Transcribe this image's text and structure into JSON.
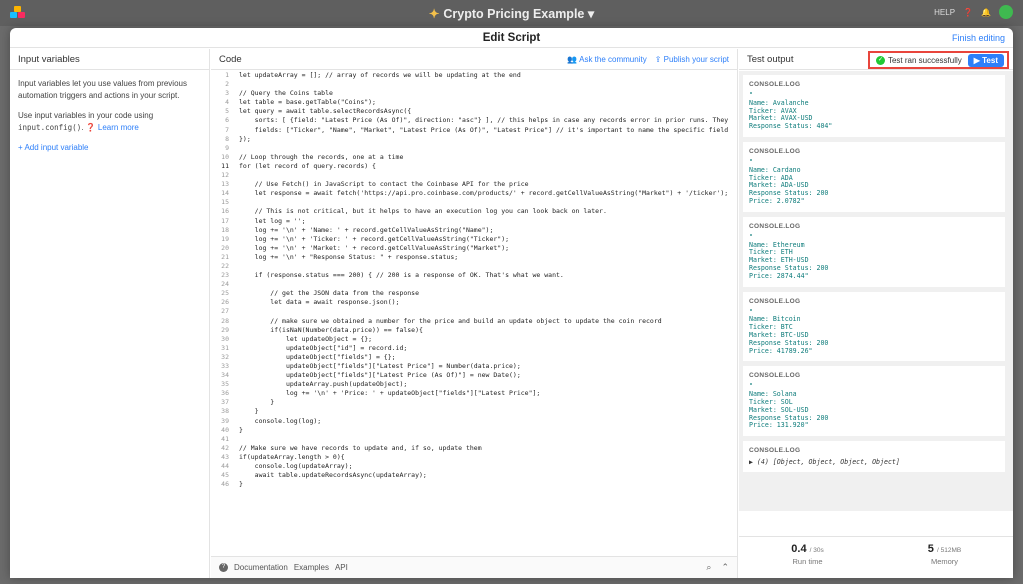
{
  "appbar": {
    "title": "Crypto Pricing Example",
    "help_label": "HELP",
    "icons": [
      "app-logo-icon",
      "sparkle-icon",
      "help-icon",
      "bell-icon",
      "avatar"
    ]
  },
  "modal": {
    "title": "Edit Script",
    "finish_label": "Finish editing"
  },
  "left": {
    "header": "Input variables",
    "para1": "Input variables let you use values from previous automation triggers and actions in your script.",
    "para2_prefix": "Use input variables in your code using",
    "para2_code": "input.config()",
    "para2_suffix": ".",
    "learn_more": "Learn more",
    "add_label": "+ Add input variable"
  },
  "code": {
    "header": "Code",
    "ask_label": "Ask the community",
    "publish_label": "Publish your script",
    "active_line": 11,
    "lines": [
      "let updateArray = []; // array of records we will be updating at the end",
      "",
      "// Query the Coins table",
      "let table = base.getTable(\"Coins\");",
      "let query = await table.selectRecordsAsync({",
      "    sorts: [ {field: \"Latest Price (As Of)\", direction: \"asc\"} ], // this helps in case any records error in prior runs. They",
      "    fields: [\"Ticker\", \"Name\", \"Market\", \"Latest Price (As Of)\", \"Latest Price\"] // it's important to name the specific field",
      "});",
      "",
      "// Loop through the records, one at a time",
      "for (let record of query.records) {",
      "",
      "    // Use Fetch() in JavaScript to contact the Coinbase API for the price",
      "    let response = await fetch('https://api.pro.coinbase.com/products/' + record.getCellValueAsString(\"Market\") + '/ticker');",
      "",
      "    // This is not critical, but it helps to have an execution log you can look back on later.",
      "    let log = '';",
      "    log += '\\n' + 'Name: ' + record.getCellValueAsString(\"Name\");",
      "    log += '\\n' + 'Ticker: ' + record.getCellValueAsString(\"Ticker\");",
      "    log += '\\n' + 'Market: ' + record.getCellValueAsString(\"Market\");",
      "    log += '\\n' + \"Response Status: \" + response.status;",
      "",
      "    if (response.status === 200) { // 200 is a response of OK. That's what we want.",
      "",
      "        // get the JSON data from the response",
      "        let data = await response.json();",
      "",
      "        // make sure we obtained a number for the price and build an update object to update the coin record",
      "        if(isNaN(Number(data.price)) == false){",
      "            let updateObject = {};",
      "            updateObject[\"id\"] = record.id;",
      "            updateObject[\"fields\"] = {};",
      "            updateObject[\"fields\"][\"Latest Price\"] = Number(data.price);",
      "            updateObject[\"fields\"][\"Latest Price (As Of)\"] = new Date();",
      "            updateArray.push(updateObject);",
      "            log += '\\n' + 'Price: ' + updateObject[\"fields\"][\"Latest Price\"];",
      "        }",
      "    }",
      "    console.log(log);",
      "}",
      "",
      "// Make sure we have records to update and, if so, update them",
      "if(updateArray.length > 0){",
      "    console.log(updateArray);",
      "    await table.updateRecordsAsync(updateArray);",
      "}"
    ],
    "footer": {
      "doc_label": "Documentation",
      "examples_label": "Examples",
      "api_label": "API"
    }
  },
  "right": {
    "header": "Test output",
    "status_text": "Test ran successfully",
    "test_label": "Test",
    "logs": [
      {
        "label": "CONSOLE.LOG",
        "text": "\"\nName: Avalanche\nTicker: AVAX\nMarket: AVAX-USD\nResponse Status: 404\""
      },
      {
        "label": "CONSOLE.LOG",
        "text": "\"\nName: Cardano\nTicker: ADA\nMarket: ADA-USD\nResponse Status: 200\nPrice: 2.0782\""
      },
      {
        "label": "CONSOLE.LOG",
        "text": "\"\nName: Ethereum\nTicker: ETH\nMarket: ETH-USD\nResponse Status: 200\nPrice: 2874.44\""
      },
      {
        "label": "CONSOLE.LOG",
        "text": "\"\nName: Bitcoin\nTicker: BTC\nMarket: BTC-USD\nResponse Status: 200\nPrice: 41789.26\""
      },
      {
        "label": "CONSOLE.LOG",
        "text": "\"\nName: Solana\nTicker: SOL\nMarket: SOL-USD\nResponse Status: 200\nPrice: 131.920\""
      },
      {
        "label": "CONSOLE.LOG",
        "text": "▶ (4) [Object, Object, Object, Object]"
      }
    ],
    "stats": {
      "runtime_value": "0.4",
      "runtime_unit": "/ 30s",
      "runtime_label": "Run time",
      "memory_value": "5",
      "memory_unit": "/ 512MB",
      "memory_label": "Memory"
    }
  }
}
